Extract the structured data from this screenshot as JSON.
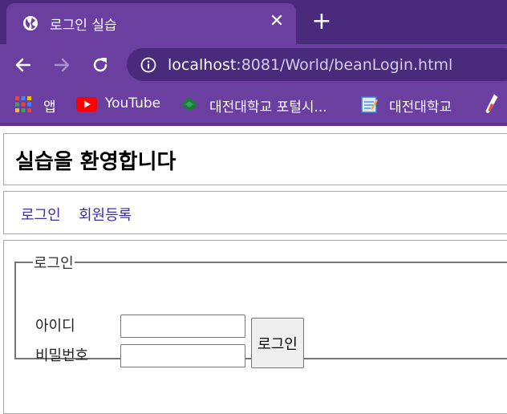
{
  "browser": {
    "tab": {
      "title": "로그인 실습",
      "favicon": "globe-icon"
    },
    "new_tab_symbol": "+",
    "close_symbol": "✕",
    "address": {
      "host": "localhost",
      "rest": ":8081/World/beanLogin.html"
    },
    "bookmarks": [
      {
        "label": "앱",
        "icon": "apps-grid-icon"
      },
      {
        "label": "YouTube",
        "icon": "youtube-icon"
      },
      {
        "label": "대전대학교 포털시...",
        "icon": "university-logo-icon"
      },
      {
        "label": "대전대학교",
        "icon": "notepad-icon"
      }
    ]
  },
  "page": {
    "title": "실습을 환영합니다",
    "nav": [
      {
        "label": "로그인"
      },
      {
        "label": "회원등록"
      }
    ],
    "login": {
      "legend": "로그인",
      "id_label": "아이디",
      "password_label": "비밀번호",
      "id_value": "",
      "password_value": "",
      "submit_label": "로그인"
    }
  },
  "colors": {
    "chrome_dark": "#4a2a7a",
    "chrome_tab": "#6a3fa0",
    "link": "#3c2ca8"
  }
}
